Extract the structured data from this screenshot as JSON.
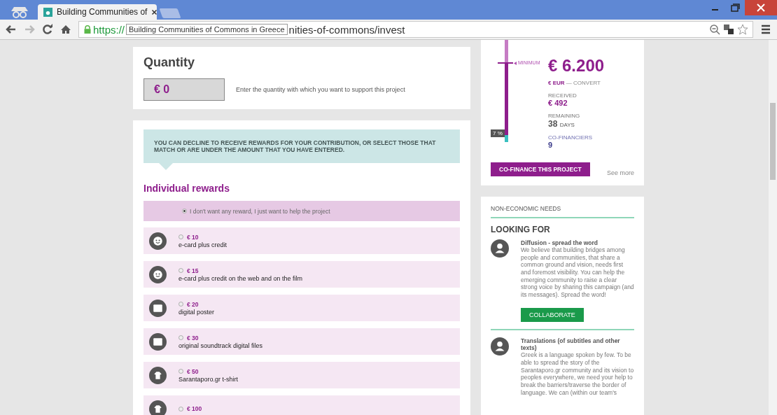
{
  "browser": {
    "tab_title": "Building Communities of",
    "address_scheme": "https://",
    "address_tooltip": "Building Communities of Commons in Greece",
    "address_rest": "nities-of-commons/invest"
  },
  "quantity": {
    "title": "Quantity",
    "value": "€ 0",
    "hint": "Enter the quantity with which you want to support this project"
  },
  "rewards": {
    "notice": "YOU CAN DECLINE TO RECEIVE REWARDS FOR YOUR CONTRIBUTION, OR SELECT THOSE THAT MATCH OR ARE UNDER THE AMOUNT THAT YOU HAVE ENTERED.",
    "heading": "Individual rewards",
    "no_reward": {
      "label": "I don't want any reward, I just want to help the project",
      "selected": true
    },
    "items": [
      {
        "kind": "ecard",
        "price": "€ 10",
        "description": "e-card plus credit",
        "selected": false
      },
      {
        "kind": "ecard",
        "price": "€ 15",
        "description": "e-card plus credit on the web and on the film",
        "selected": false
      },
      {
        "kind": "digital",
        "price": "€ 20",
        "description": "digital poster",
        "selected": false
      },
      {
        "kind": "digital",
        "price": "€ 30",
        "description": "original soundtrack digital files",
        "selected": false
      },
      {
        "kind": "merch",
        "price": "€ 50",
        "description": "Sarantaporo.gr t-shirt",
        "selected": false
      },
      {
        "kind": "merch",
        "price": "€ 100",
        "selected": false
      }
    ]
  },
  "funding": {
    "minimum_label": "MINIMUM",
    "minimum": "€ 6.200",
    "currency": "€ EUR",
    "dash": "—",
    "convert": "CONVERT",
    "received_label": "RECEIVED",
    "received": "€ 492",
    "remaining_label": "REMAINING",
    "remaining": "38",
    "remaining_unit": "DAYS",
    "cofinanciers_label": "CO-FINANCIERS",
    "cofinanciers": "9",
    "percent": "7 %",
    "level": 0.07,
    "button": "CO-FINANCE THIS PROJECT",
    "see_more": "See more"
  },
  "needs": {
    "section": "NON-ECONOMIC NEEDS",
    "heading": "LOOKING FOR",
    "items": [
      {
        "title": "Diffusion - spread the word",
        "text": "We believe that building bridges among people and communities, that share a common ground and vision, needs first and foremost visibility. You can help the emerging community to raise a clear strong voice by sharing this campaign (and its messages). Spread the word!",
        "button": "COLLABORATE"
      },
      {
        "title": "Translations (of subtitles and other texts)",
        "text": "Greek is a language spoken by few. To be able to spread the story of the Sarantaporo.gr community and its vision to peoples everywhere, we need your help to break the barriers/traverse the border of language. We can (within our team's"
      }
    ]
  }
}
